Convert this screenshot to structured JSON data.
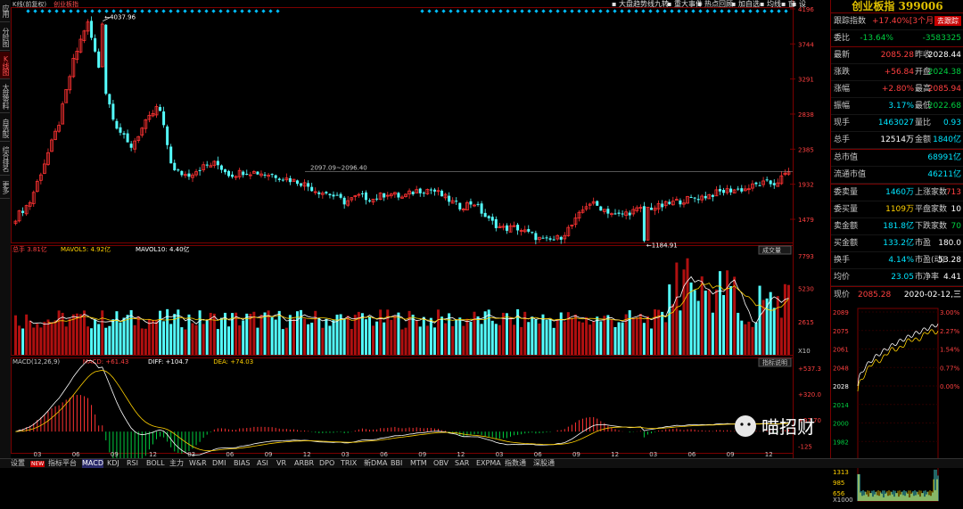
{
  "header": {
    "title": "K线(前复权)",
    "subtitle": "创业板指"
  },
  "top_links": [
    "大盘趋势线九转",
    "重大事件",
    "热点回顾",
    "加自选",
    "均线",
    "窗",
    "设"
  ],
  "side_tabs": [
    {
      "label": "应用",
      "active": false
    },
    {
      "label": "分时图",
      "active": false
    },
    {
      "label": "K线图",
      "active": true
    },
    {
      "label": "大盘资料",
      "active": false
    },
    {
      "label": "自选股",
      "active": false
    },
    {
      "label": "综合排名",
      "active": false
    },
    {
      "label": "更多",
      "active": false
    }
  ],
  "main_chart": {
    "y_ticks": [
      "4196",
      "3744",
      "3291",
      "2838",
      "2385",
      "1932",
      "1479"
    ],
    "y_range": [
      1180,
      4196
    ],
    "annotations": {
      "high": "4037.96",
      "low": "1184.91",
      "level_label": "2097.09~2096.40"
    }
  },
  "volume_panel": {
    "legend": [
      {
        "text": "总手 3.81亿",
        "color": "#ff4040"
      },
      {
        "text": "MAVOL5: 4.92亿",
        "color": "#ffd000"
      },
      {
        "text": "MAVOL10: 4.40亿",
        "color": "#ffffff"
      }
    ],
    "button": "成交量",
    "y_ticks": [
      "7793",
      "5230",
      "2615"
    ],
    "unit": "X10"
  },
  "macd_panel": {
    "legend": [
      {
        "text": "MACD(12,26,9)",
        "color": "#c8c8c8"
      },
      {
        "text": "MACD: +61.43",
        "color": "#ff4040"
      },
      {
        "text": "DIFF: +104.7",
        "color": "#ffffff"
      },
      {
        "text": "DEA: +74.03",
        "color": "#ffd000"
      }
    ],
    "button": "指标说明",
    "y_ticks": [
      "+537.3",
      "+320.0",
      "+97.70",
      "-125"
    ]
  },
  "x_ticks": [
    "03",
    "06",
    "09",
    "12",
    "03",
    "06",
    "09",
    "12",
    "03",
    "06",
    "09",
    "12",
    "03",
    "06",
    "09",
    "12",
    "03",
    "06",
    "09",
    "12"
  ],
  "chart_data": {
    "type": "candlestick",
    "title": "创业板指 K线(前复权)",
    "ylim": [
      1180,
      4196
    ],
    "x": [
      "03",
      "06",
      "09",
      "12",
      "03",
      "06",
      "09",
      "12",
      "03",
      "06",
      "09",
      "12",
      "03",
      "06",
      "09",
      "12",
      "03",
      "06",
      "09",
      "12"
    ],
    "close_path": [
      1500,
      1700,
      2200,
      2700,
      3500,
      4038,
      3300,
      2700,
      2400,
      2700,
      2950,
      2100,
      2050,
      2150,
      2200,
      2050,
      2100,
      2080,
      2050,
      2000,
      1950,
      1850,
      1800,
      1700,
      1780,
      1740,
      1820,
      1760,
      1850,
      1870,
      1760,
      1640,
      1700,
      1470,
      1360,
      1370,
      1280,
      1190,
      1240,
      1430,
      1700,
      1620,
      1520,
      1580,
      1620,
      1640,
      1700,
      1740,
      1770,
      1820,
      1860,
      1870,
      1940,
      1940,
      2085
    ],
    "high": 4037.96,
    "low": 1184.91,
    "volume_peak": 7793,
    "macd_peak": 537.3,
    "macd_low": -125
  },
  "right_panel": {
    "title": "创业板指  399006",
    "follow": {
      "label": "跟踪指数",
      "value": "+17.40%[3个月]",
      "button": "去跟踪"
    },
    "commission": {
      "label": "委比",
      "value": "-13.64%",
      "value2": "-3583325"
    },
    "rows": [
      {
        "l1": "最新",
        "v1": "2085.28",
        "c1": "red",
        "l2": "昨收",
        "v2": "2028.44",
        "c2": "white"
      },
      {
        "l1": "涨跌",
        "v1": "+56.84",
        "c1": "red",
        "l2": "开盘",
        "v2": "2024.38",
        "c2": "green"
      },
      {
        "l1": "涨幅",
        "v1": "+2.80%",
        "c1": "red",
        "l2": "最高",
        "v2": "2085.94",
        "c2": "red"
      },
      {
        "l1": "振幅",
        "v1": "3.17%",
        "c1": "cyan",
        "l2": "最低",
        "v2": "2022.68",
        "c2": "green"
      },
      {
        "l1": "现手",
        "v1": "1463027",
        "c1": "cyan",
        "l2": "量比",
        "v2": "0.93",
        "c2": "cyan"
      },
      {
        "l1": "总手",
        "v1": "12514万",
        "c1": "white",
        "l2": "金额",
        "v2": "1840亿",
        "c2": "cyan"
      }
    ],
    "market": [
      {
        "l": "总市值",
        "v": "68991亿"
      },
      {
        "l": "流通市值",
        "v": "46211亿"
      }
    ],
    "rows2": [
      {
        "l1": "委卖量",
        "v1": "1460万",
        "c1": "cyan",
        "l2": "上涨家数",
        "v2": "713",
        "c2": "red"
      },
      {
        "l1": "委买量",
        "v1": "1109万",
        "c1": "yellow",
        "l2": "平盘家数",
        "v2": "10",
        "c2": "white"
      },
      {
        "l1": "卖金额",
        "v1": "181.8亿",
        "c1": "cyan",
        "l2": "下跌家数",
        "v2": "70",
        "c2": "green"
      },
      {
        "l1": "买金额",
        "v1": "133.2亿",
        "c1": "cyan",
        "l2": "市盈",
        "v2": "180.0",
        "c2": "white"
      },
      {
        "l1": "换手",
        "v1": "4.14%",
        "c1": "cyan",
        "l2": "市盈(动)",
        "v2": "53.28",
        "c2": "white"
      },
      {
        "l1": "均价",
        "v1": "23.05",
        "c1": "cyan",
        "l2": "市净率",
        "v2": "4.41",
        "c2": "white"
      }
    ],
    "intraday": {
      "label": "现价",
      "price": "2085.28",
      "date": "2020-02-12,三",
      "left_ticks": [
        "2089",
        "2075",
        "2061",
        "2048",
        "2028",
        "2014",
        "2000",
        "1982",
        "1968"
      ],
      "right_ticks": [
        "3.00%",
        "2.27%",
        "1.54%",
        "0.77%",
        "0.00%"
      ],
      "vol_ticks": [
        "1313",
        "985",
        "656"
      ],
      "vol_unit": "X1000"
    }
  },
  "watermark": "喵招财",
  "bottom_tabs": [
    "设置",
    "NEW",
    "指标平台",
    "MACD",
    "KDJ",
    "RSI",
    "BOLL",
    "主力",
    "W&R",
    "DMI",
    "BIAS",
    "ASI",
    "VR",
    "ARBR",
    "DPO",
    "TRIX",
    "新DMA",
    "BBI",
    "MTM",
    "OBV",
    "SAR",
    "EXPMA",
    "指数通",
    "深股通"
  ],
  "active_bottom_tab": "MACD",
  "colors": {
    "up": "#ff3232",
    "down": "#54ffff",
    "ma5": "#ffffff",
    "ma10": "#ffd000",
    "panel_border": "#7a0000"
  }
}
